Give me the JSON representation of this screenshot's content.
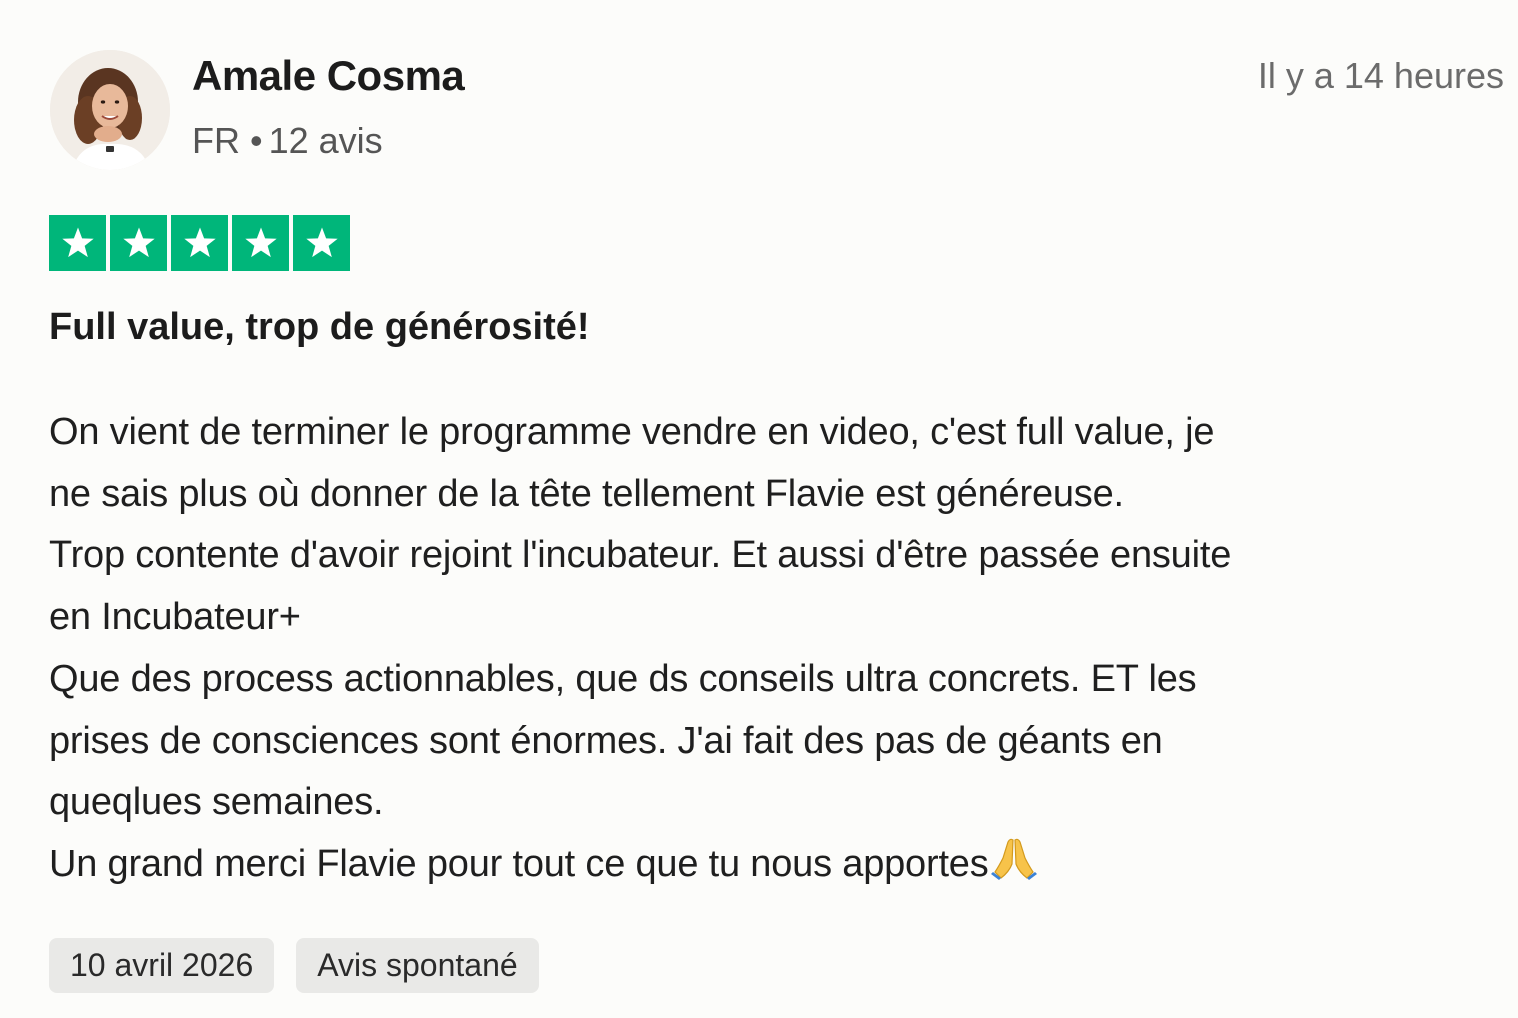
{
  "reviewer": {
    "name": "Amale Cosma",
    "country": "FR",
    "separator": "•",
    "review_count": "12 avis",
    "avatar_icon": "user-avatar-photo"
  },
  "timestamp": "Il y a 14 heures",
  "rating": {
    "stars": 5,
    "max": 5,
    "color": "#00b67a",
    "icon": "star-icon"
  },
  "review": {
    "title": "Full value, trop de générosité!",
    "body_lines": [
      "On vient de terminer le programme vendre en video, c'est full value, je",
      "ne sais plus où donner de la tête tellement Flavie est généreuse.",
      "Trop contente d'avoir rejoint l'incubateur. Et aussi d'être passée ensuite",
      "en Incubateur+",
      "Que des process actionnables, que ds conseils ultra concrets. ET les",
      "prises de consciences sont énormes. J'ai fait des pas de géants en",
      "queqlues semaines.",
      "Un grand merci Flavie pour tout ce que tu nous apportes"
    ],
    "trailing_emoji": "praying-hands-icon"
  },
  "tags": {
    "date": "10 avril 2026",
    "type": "Avis spontané"
  }
}
